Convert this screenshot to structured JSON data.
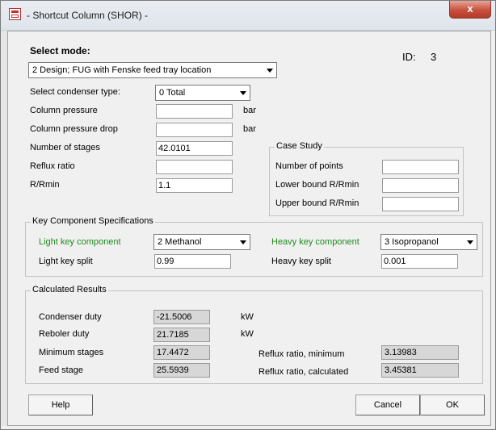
{
  "window": {
    "title": "- Shortcut Column (SHOR) -",
    "close_label": "x"
  },
  "header": {
    "select_mode_label": "Select mode:",
    "mode_value": "2 Design; FUG with Fenske feed tray location",
    "id_label": "ID:",
    "id_value": "3"
  },
  "inputs": {
    "condenser_type_label": "Select condenser type:",
    "condenser_type_value": "0 Total",
    "pressure_label": "Column pressure",
    "pressure_value": "",
    "pressure_unit": "bar",
    "pressure_drop_label": "Column pressure drop",
    "pressure_drop_value": "",
    "pressure_drop_unit": "bar",
    "stages_label": "Number of stages",
    "stages_value": "42.0101",
    "reflux_label": "Reflux ratio",
    "reflux_value": "",
    "rrmin_label": "R/Rmin",
    "rrmin_value": "1.1"
  },
  "case_study": {
    "title": "Case Study",
    "points_label": "Number of points",
    "points_value": "",
    "lower_label": "Lower bound R/Rmin",
    "lower_value": "",
    "upper_label": "Upper bound R/Rmin",
    "upper_value": ""
  },
  "key_components": {
    "title": "Key Component Specifications",
    "light_label": "Light key component",
    "light_value": "2 Methanol",
    "light_split_label": "Light key split",
    "light_split_value": "0.99",
    "heavy_label": "Heavy key component",
    "heavy_value": "3 Isopropanol",
    "heavy_split_label": "Heavy key split",
    "heavy_split_value": "0.001"
  },
  "results": {
    "title": "Calculated Results",
    "condenser_label": "Condenser duty",
    "condenser_value": "-21.5006",
    "condenser_unit": "kW",
    "reboiler_label": "Reboler duty",
    "reboiler_value": "21.7185",
    "reboiler_unit": "kW",
    "min_stages_label": "Minimum stages",
    "min_stages_value": "17.4472",
    "feed_stage_label": "Feed stage",
    "feed_stage_value": "25.5939",
    "reflux_min_label": "Reflux ratio, minimum",
    "reflux_min_value": "3.13983",
    "reflux_calc_label": "Reflux ratio, calculated",
    "reflux_calc_value": "3.45381"
  },
  "buttons": {
    "help": "Help",
    "cancel": "Cancel",
    "ok": "OK"
  }
}
